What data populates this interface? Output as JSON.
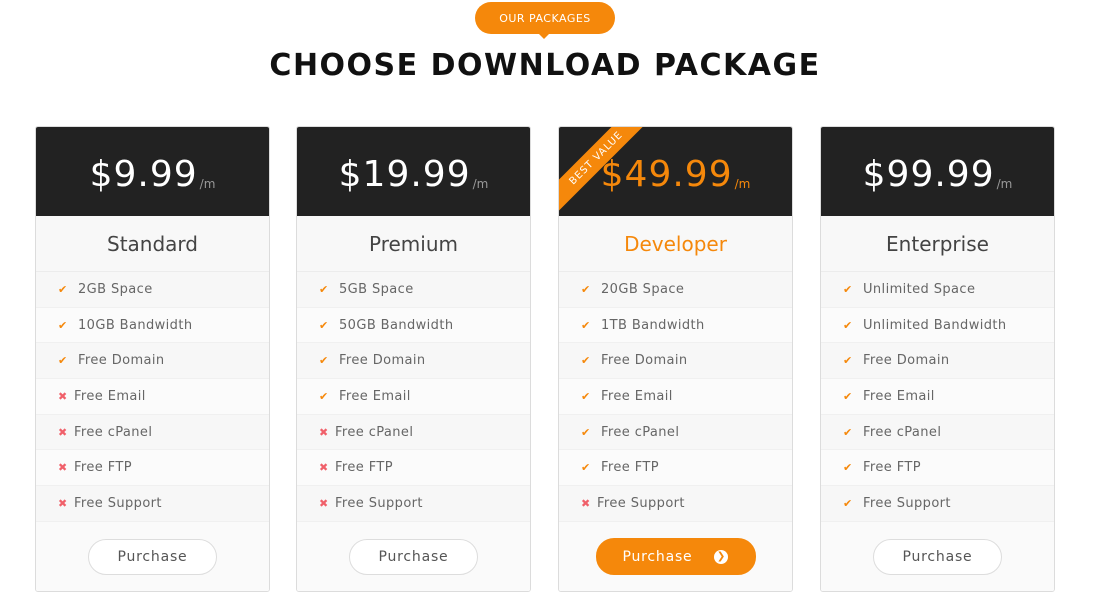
{
  "header": {
    "badge": "OUR PACKAGES",
    "title": "CHOOSE DOWNLOAD PACKAGE"
  },
  "colors": {
    "accent": "#f5880b",
    "dark": "#222222",
    "cross": "#f0606a"
  },
  "plans": [
    {
      "price": "$9.99",
      "period": "/m",
      "name": "Standard",
      "button": "Purchase",
      "features": [
        {
          "label": "2GB Space",
          "included": true
        },
        {
          "label": "10GB Bandwidth",
          "included": true
        },
        {
          "label": "Free Domain",
          "included": true
        },
        {
          "label": "Free Email",
          "included": false
        },
        {
          "label": "Free cPanel",
          "included": false
        },
        {
          "label": "Free FTP",
          "included": false
        },
        {
          "label": "Free Support",
          "included": false
        }
      ]
    },
    {
      "price": "$19.99",
      "period": "/m",
      "name": "Premium",
      "button": "Purchase",
      "features": [
        {
          "label": "5GB Space",
          "included": true
        },
        {
          "label": "50GB Bandwidth",
          "included": true
        },
        {
          "label": "Free Domain",
          "included": true
        },
        {
          "label": "Free Email",
          "included": true
        },
        {
          "label": "Free cPanel",
          "included": false
        },
        {
          "label": "Free FTP",
          "included": false
        },
        {
          "label": "Free Support",
          "included": false
        }
      ]
    },
    {
      "price": "$49.99",
      "period": "/m",
      "name": "Developer",
      "button": "Purchase",
      "ribbon": "BEST VALUE",
      "featured": true,
      "features": [
        {
          "label": "20GB Space",
          "included": true
        },
        {
          "label": "1TB Bandwidth",
          "included": true
        },
        {
          "label": "Free Domain",
          "included": true
        },
        {
          "label": "Free Email",
          "included": true
        },
        {
          "label": "Free cPanel",
          "included": true
        },
        {
          "label": "Free FTP",
          "included": true
        },
        {
          "label": "Free Support",
          "included": false
        }
      ]
    },
    {
      "price": "$99.99",
      "period": "/m",
      "name": "Enterprise",
      "button": "Purchase",
      "features": [
        {
          "label": "Unlimited Space",
          "included": true
        },
        {
          "label": "Unlimited Bandwidth",
          "included": true
        },
        {
          "label": "Free Domain",
          "included": true
        },
        {
          "label": "Free Email",
          "included": true
        },
        {
          "label": "Free cPanel",
          "included": true
        },
        {
          "label": "Free FTP",
          "included": true
        },
        {
          "label": "Free Support",
          "included": true
        }
      ]
    }
  ]
}
